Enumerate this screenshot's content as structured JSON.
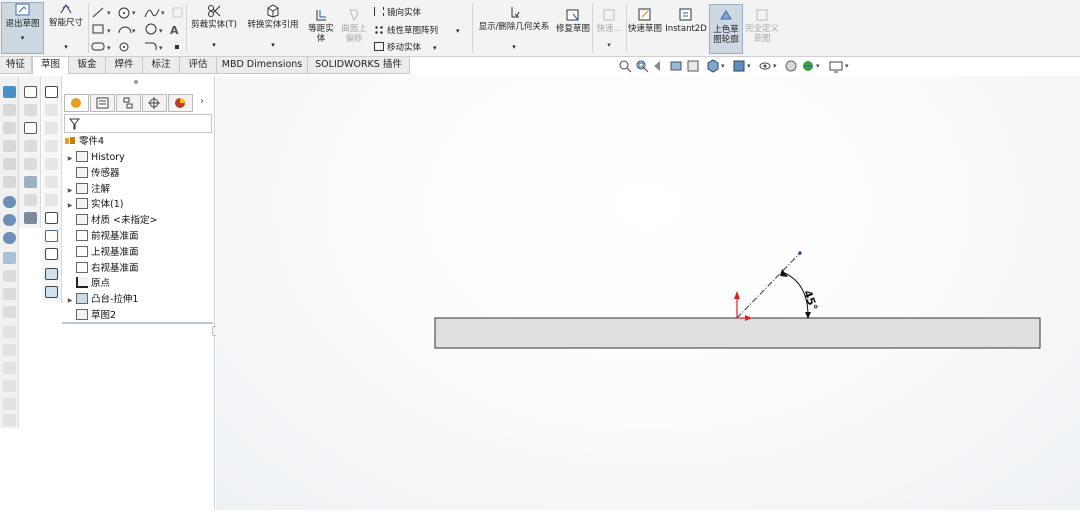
{
  "ribbon": {
    "exit_sketch": "退出草图",
    "smart_dimension": "智能尺寸",
    "trim": "剪裁实体(T)",
    "convert": "转换实体引用",
    "offset": "等距实体",
    "surface_offset": "曲面上偏移",
    "mirror": "镜向实体",
    "linear_pattern": "线性草图阵列",
    "move": "移动实体",
    "relations": "显示/删除几何关系",
    "repair": "修复草图",
    "quick_snaps": "快速...",
    "rapid_sketch": "快速草图",
    "instant2d": "Instant2D",
    "shaded_contour": "上色草图轮廓",
    "fully_define": "完全定义草图"
  },
  "tabs": [
    "特征",
    "草图",
    "钣金",
    "焊件",
    "标注",
    "评估",
    "MBD Dimensions",
    "SOLIDWORKS 插件"
  ],
  "active_tab": "草图",
  "tree": {
    "root": "零件4",
    "items": [
      {
        "label": "History",
        "expandable": true
      },
      {
        "label": "传感器",
        "expandable": false
      },
      {
        "label": "注解",
        "expandable": true
      },
      {
        "label": "实体(1)",
        "expandable": true
      },
      {
        "label": "材质 <未指定>",
        "expandable": false
      },
      {
        "label": "前视基准面",
        "expandable": false
      },
      {
        "label": "上视基准面",
        "expandable": false
      },
      {
        "label": "右视基准面",
        "expandable": false
      },
      {
        "label": "原点",
        "expandable": false
      },
      {
        "label": "凸台-拉伸1",
        "expandable": true
      },
      {
        "label": "草图2",
        "expandable": false
      }
    ]
  },
  "canvas": {
    "angle_label": "45°"
  },
  "colors": {
    "accent": "#cdd8e3",
    "axis_red": "#e02020",
    "sketch_blue": "#1a2fa0"
  }
}
